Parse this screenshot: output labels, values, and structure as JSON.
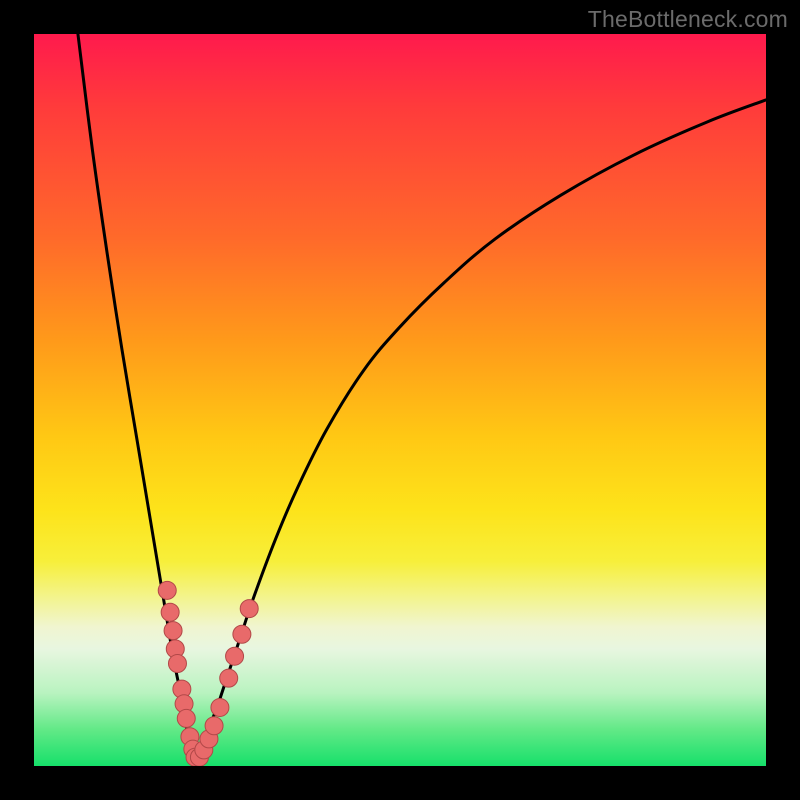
{
  "watermark": "TheBottleneck.com",
  "colors": {
    "frame": "#000000",
    "curve": "#000000",
    "marker_fill": "#e86a6a",
    "marker_stroke": "#b24848"
  },
  "chart_data": {
    "type": "line",
    "title": "",
    "xlabel": "",
    "ylabel": "",
    "xlim": [
      0,
      100
    ],
    "ylim": [
      0,
      100
    ],
    "grid": false,
    "legend": false,
    "series": [
      {
        "name": "left-branch",
        "x": [
          6,
          8,
          10,
          12,
          14,
          16,
          18,
          19,
          20,
          20.5,
          21,
          21.5,
          22
        ],
        "y": [
          100,
          84,
          70,
          57,
          45,
          33,
          21,
          15,
          10,
          7,
          4.5,
          2.5,
          1
        ]
      },
      {
        "name": "right-branch",
        "x": [
          22,
          23,
          24,
          25,
          26,
          28,
          30,
          33,
          36,
          40,
          45,
          50,
          56,
          63,
          72,
          82,
          92,
          100
        ],
        "y": [
          1,
          3,
          5.5,
          8,
          11,
          17,
          23,
          31,
          38,
          46,
          54,
          60,
          66,
          72,
          78,
          83.5,
          88,
          91
        ]
      }
    ],
    "markers": [
      {
        "x": 18.2,
        "y": 24
      },
      {
        "x": 18.6,
        "y": 21
      },
      {
        "x": 19.0,
        "y": 18.5
      },
      {
        "x": 19.3,
        "y": 16
      },
      {
        "x": 19.6,
        "y": 14
      },
      {
        "x": 20.2,
        "y": 10.5
      },
      {
        "x": 20.5,
        "y": 8.5
      },
      {
        "x": 20.8,
        "y": 6.5
      },
      {
        "x": 21.3,
        "y": 4
      },
      {
        "x": 21.7,
        "y": 2.3
      },
      {
        "x": 22.0,
        "y": 1.2
      },
      {
        "x": 22.6,
        "y": 1.2
      },
      {
        "x": 23.2,
        "y": 2.2
      },
      {
        "x": 23.9,
        "y": 3.7
      },
      {
        "x": 24.6,
        "y": 5.5
      },
      {
        "x": 25.4,
        "y": 8
      },
      {
        "x": 26.6,
        "y": 12
      },
      {
        "x": 27.4,
        "y": 15
      },
      {
        "x": 28.4,
        "y": 18
      },
      {
        "x": 29.4,
        "y": 21.5
      }
    ],
    "marker_radius": 9
  }
}
